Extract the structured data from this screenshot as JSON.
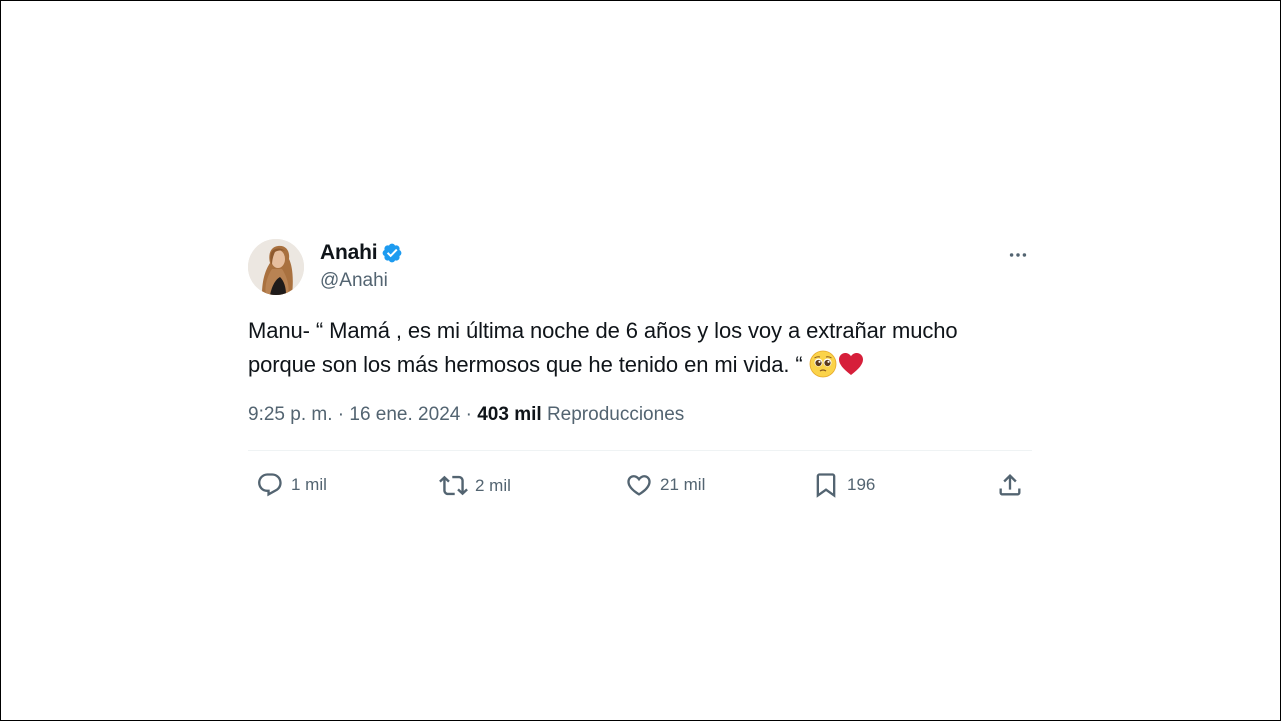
{
  "author": {
    "display_name": "Anahi",
    "handle": "@Anahi",
    "verified": true,
    "verified_color": "#1d9bf0"
  },
  "tweet": {
    "text_line1": "Manu- “ Mamá , es mi última noche de 6 años y los voy a extrañar mucho",
    "text_line2": "porque son los más hermosos que he tenido en mi vida. “",
    "emojis": [
      "pleading-face-emoji",
      "red-heart-emoji"
    ]
  },
  "meta": {
    "time": "9:25 p. m.",
    "separator": "·",
    "date": "16 ene. 2024",
    "views_count": "403 mil",
    "views_label": "Reproducciones"
  },
  "actions": {
    "replies": "1 mil",
    "reposts": "2 mil",
    "likes": "21 mil",
    "bookmarks": "196"
  },
  "icons": {
    "more": "more-dots-icon",
    "reply": "reply-icon",
    "repost": "repost-icon",
    "like": "heart-icon",
    "bookmark": "bookmark-icon",
    "share": "share-icon"
  },
  "colors": {
    "text_primary": "#0f1419",
    "text_secondary": "#536471",
    "divider": "#eff3f4",
    "heart_emoji": "#d61f3a"
  }
}
